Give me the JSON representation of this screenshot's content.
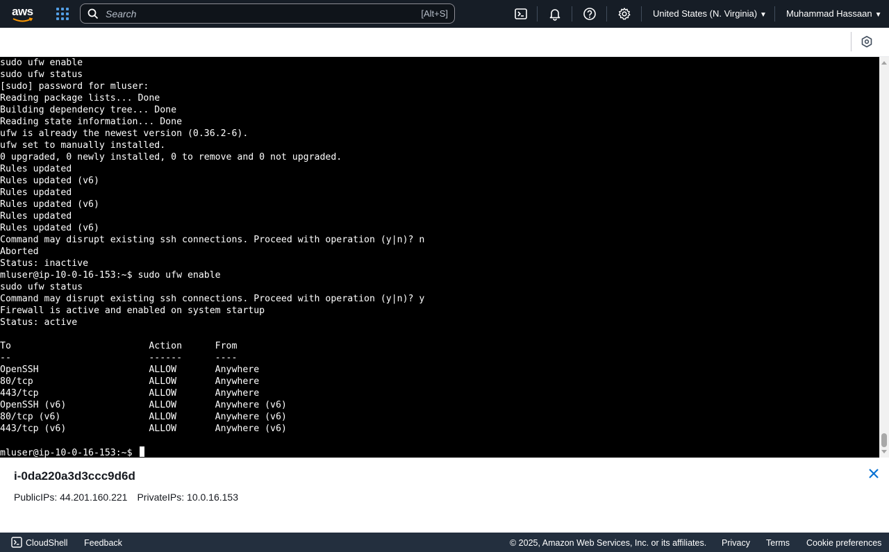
{
  "nav": {
    "logo_text": "aws",
    "search_placeholder": "Search",
    "search_shortcut": "[Alt+S]",
    "region": "United States (N. Virginia)",
    "user": "Muhammad Hassaan"
  },
  "terminal": {
    "lines": [
      "sudo ufw enable",
      "sudo ufw status",
      "[sudo] password for mluser:",
      "Reading package lists... Done",
      "Building dependency tree... Done",
      "Reading state information... Done",
      "ufw is already the newest version (0.36.2-6).",
      "ufw set to manually installed.",
      "0 upgraded, 0 newly installed, 0 to remove and 0 not upgraded.",
      "Rules updated",
      "Rules updated (v6)",
      "Rules updated",
      "Rules updated (v6)",
      "Rules updated",
      "Rules updated (v6)",
      "Command may disrupt existing ssh connections. Proceed with operation (y|n)? n",
      "Aborted",
      "Status: inactive",
      "mluser@ip-10-0-16-153:~$ sudo ufw enable",
      "sudo ufw status",
      "Command may disrupt existing ssh connections. Proceed with operation (y|n)? y",
      "Firewall is active and enabled on system startup",
      "Status: active",
      "",
      "To                         Action      From",
      "--                         ------      ----",
      "OpenSSH                    ALLOW       Anywhere",
      "80/tcp                     ALLOW       Anywhere",
      "443/tcp                    ALLOW       Anywhere",
      "OpenSSH (v6)               ALLOW       Anywhere (v6)",
      "80/tcp (v6)                ALLOW       Anywhere (v6)",
      "443/tcp (v6)               ALLOW       Anywhere (v6)",
      ""
    ],
    "prompt": "mluser@ip-10-0-16-153:~$ "
  },
  "instance": {
    "id": "i-0da220a3d3ccc9d6d",
    "public_ips": "PublicIPs: 44.201.160.221",
    "private_ips": "PrivateIPs: 10.0.16.153"
  },
  "footer": {
    "cloudshell": "CloudShell",
    "feedback": "Feedback",
    "copyright": "© 2025, Amazon Web Services, Inc. or its affiliates.",
    "privacy": "Privacy",
    "terms": "Terms",
    "cookie": "Cookie preferences"
  },
  "colors": {
    "nav_bg": "#161d26",
    "terminal_bg": "#000000",
    "footer_bg": "#232f3e",
    "apps_icon": "#539fe5"
  }
}
